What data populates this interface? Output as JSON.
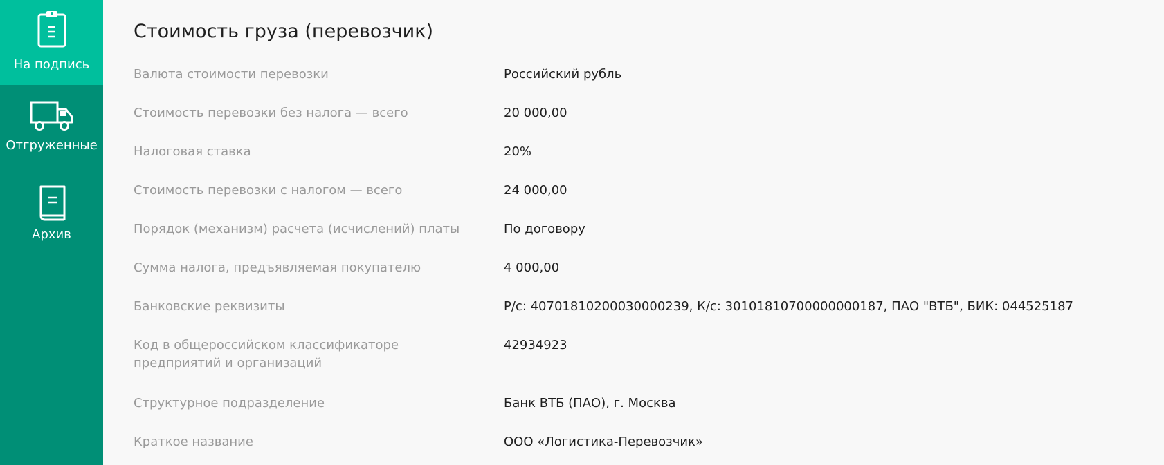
{
  "sidebar": {
    "items": [
      {
        "label": "На подпись",
        "icon": "clipboard-icon",
        "active": true
      },
      {
        "label": "Отгруженные",
        "icon": "truck-icon",
        "active": false
      },
      {
        "label": "Архив",
        "icon": "book-icon",
        "active": false
      }
    ]
  },
  "main": {
    "title": "Стоимость груза (перевозчик)",
    "fields": [
      {
        "label": "Валюта стоимости перевозки",
        "value": "Российский рубль"
      },
      {
        "label": "Стоимость перевозки без налога — всего",
        "value": "20 000,00"
      },
      {
        "label": "Налоговая ставка",
        "value": "20%"
      },
      {
        "label": "Стоимость перевозки с налогом — всего",
        "value": "24 000,00"
      },
      {
        "label": "Порядок (механизм) расчета (исчислений) платы",
        "value": "По договору"
      },
      {
        "label": "Сумма налога, предъявляемая покупателю",
        "value": "4 000,00"
      },
      {
        "label": "Банковские реквизиты",
        "value": "Р/с: 40701810200030000239, К/с: 30101810700000000187, ПАО \"ВТБ\", БИК: 044525187"
      },
      {
        "label": "Код в общероссийском классификаторе предприятий и организаций",
        "value": "42934923"
      },
      {
        "label": "Структурное подразделение",
        "value": "Банк ВТБ (ПАО), г. Москва"
      },
      {
        "label": "Краткое название",
        "value": "ООО «Логистика-Перевозчик»"
      }
    ]
  },
  "colors": {
    "sidebar_bg": "#008f76",
    "sidebar_active_bg": "#00bf9d",
    "label_text": "#9a9a9a",
    "value_text": "#1f1f1f",
    "page_bg": "#f8f8f8"
  }
}
